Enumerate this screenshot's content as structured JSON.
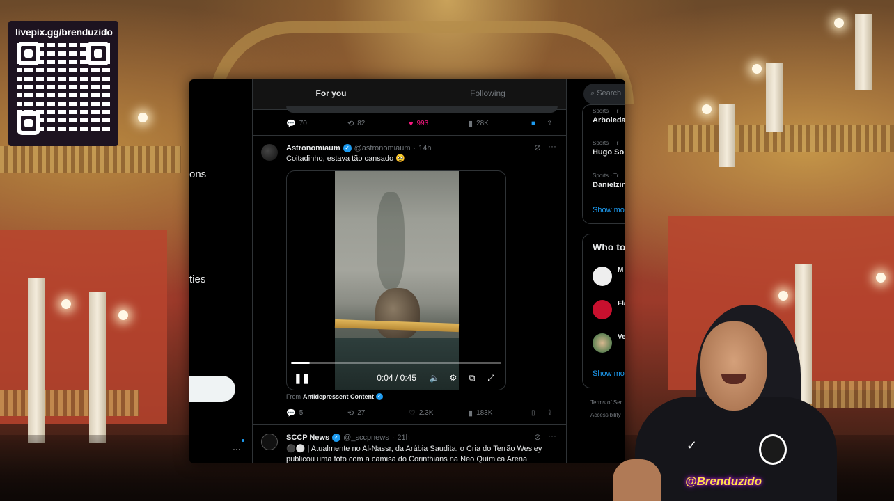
{
  "overlay": {
    "qr_url": "livepix.gg/brenduzido",
    "streamer_tag": "@Brenduzido"
  },
  "twitter": {
    "tabs": [
      {
        "label": "For you",
        "active": true
      },
      {
        "label": "Following",
        "active": false
      }
    ],
    "left_nav": {
      "fragments": [
        "ons",
        "ties"
      ],
      "more": "..."
    },
    "prev_post_actions": {
      "replies": "70",
      "reposts": "82",
      "likes": "993",
      "views": "28K"
    },
    "posts": [
      {
        "name": "Astronomiaum",
        "handle": "@astronomiaum",
        "time": "14h",
        "text": "Coitadinho, estava tão cansado 🥹",
        "video": {
          "time": "0:04 / 0:45",
          "progress": 0.09
        },
        "from_prefix": "From",
        "from_source": "Antidepressent Content",
        "actions": {
          "replies": "5",
          "reposts": "27",
          "likes": "2.3K",
          "views": "183K"
        }
      },
      {
        "name": "SCCP News",
        "handle": "@_sccpnews",
        "time": "21h",
        "text": "⚫⚪ | Atualmente no Al-Nassr, da Arábia Saudita, o Cria do Terrão Wesley publicou uma foto com a camisa do Corinthians na Neo Química Arena"
      }
    ],
    "sidebar": {
      "search_placeholder": "Search",
      "trends": [
        {
          "category": "Sports · Tr",
          "name": "Arboleda"
        },
        {
          "category": "Sports · Tr",
          "name": "Hugo So"
        },
        {
          "category": "Sports · Tr",
          "name": "Danielzin"
        }
      ],
      "show_more": "Show mo",
      "who_to_follow_title": "Who to",
      "follow_suggestions": [
        {
          "name": "M"
        },
        {
          "name": "Fla"
        },
        {
          "name": "Ve"
        }
      ],
      "show_more_2": "Show mo",
      "footer": [
        "Terms of Ser",
        "Accessibility"
      ]
    },
    "colors": {
      "accent": "#1d9bf0",
      "like": "#f91880",
      "background": "#000000"
    }
  }
}
